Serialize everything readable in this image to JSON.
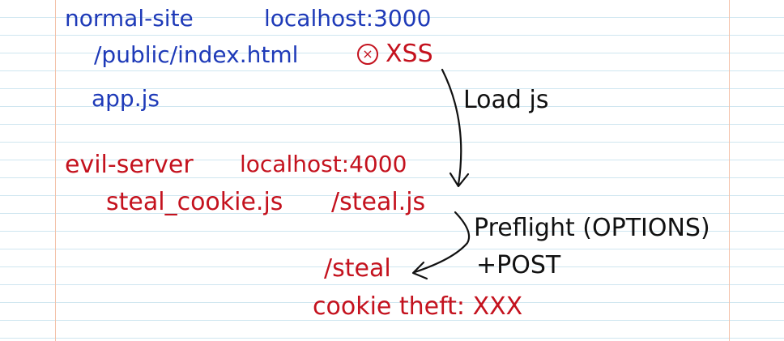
{
  "normal": {
    "name": "normal-site",
    "host": "localhost:3000",
    "file1": "/public/index.html",
    "xss": "XSS",
    "file2": "app.js"
  },
  "evil": {
    "name": "evil-server",
    "host": "localhost:4000",
    "file": "steal_cookie.js",
    "route": "/steal.js",
    "steal_route": "/steal",
    "theft": "cookie theft: XXX"
  },
  "annotations": {
    "load": "Load js",
    "preflight": "Preflight (OPTIONS)",
    "post": "+POST"
  },
  "icons": {
    "xss_marker": "circled-x-icon"
  },
  "colors": {
    "normal_site": "#1e3ab8",
    "evil_server": "#c4121e",
    "annotation": "#111111",
    "ruled_lines": "#cfe6f0",
    "margin": "#f3c1a9"
  }
}
